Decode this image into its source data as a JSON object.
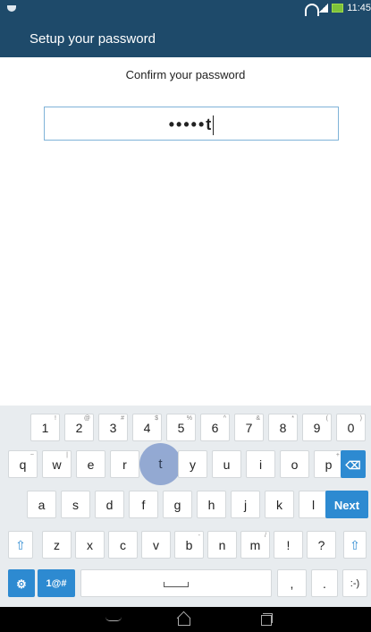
{
  "status_bar": {
    "time": "11:45"
  },
  "app_bar": {
    "title": "Setup your password"
  },
  "form": {
    "prompt": "Confirm your password",
    "password_masked": "•••••t"
  },
  "keyboard": {
    "row1": [
      {
        "label": "1",
        "hint": "!"
      },
      {
        "label": "2",
        "hint": "@"
      },
      {
        "label": "3",
        "hint": "#"
      },
      {
        "label": "4",
        "hint": "$"
      },
      {
        "label": "5",
        "hint": "%"
      },
      {
        "label": "6",
        "hint": "^"
      },
      {
        "label": "7",
        "hint": "&"
      },
      {
        "label": "8",
        "hint": "*"
      },
      {
        "label": "9",
        "hint": "("
      },
      {
        "label": "0",
        "hint": ")"
      }
    ],
    "row2": [
      {
        "label": "q",
        "hint": "~"
      },
      {
        "label": "w",
        "hint": "|"
      },
      {
        "label": "e",
        "hint": ""
      },
      {
        "label": "r",
        "hint": ""
      },
      {
        "label": "t",
        "hint": ""
      },
      {
        "label": "y",
        "hint": ""
      },
      {
        "label": "u",
        "hint": ""
      },
      {
        "label": "i",
        "hint": ""
      },
      {
        "label": "o",
        "hint": ""
      },
      {
        "label": "p",
        "hint": "+"
      }
    ],
    "row3": [
      {
        "label": "a",
        "hint": ""
      },
      {
        "label": "s",
        "hint": ""
      },
      {
        "label": "d",
        "hint": ""
      },
      {
        "label": "f",
        "hint": ""
      },
      {
        "label": "g",
        "hint": ""
      },
      {
        "label": "h",
        "hint": ""
      },
      {
        "label": "j",
        "hint": ""
      },
      {
        "label": "k",
        "hint": ""
      },
      {
        "label": "l",
        "hint": ""
      }
    ],
    "row4": [
      {
        "label": "z",
        "hint": ""
      },
      {
        "label": "x",
        "hint": ""
      },
      {
        "label": "c",
        "hint": ""
      },
      {
        "label": "v",
        "hint": ""
      },
      {
        "label": "b",
        "hint": "-"
      },
      {
        "label": "n",
        "hint": ""
      },
      {
        "label": "m",
        "hint": "/"
      },
      {
        "label": "!",
        "hint": ""
      },
      {
        "label": "?",
        "hint": ""
      }
    ],
    "next_label": "Next",
    "symbols_label": "1@#",
    "comma_label": ",",
    "period_label": ".",
    "emoticon_label": ":-)",
    "pressed_key": "t",
    "accent_color": "#2d8ad1"
  }
}
